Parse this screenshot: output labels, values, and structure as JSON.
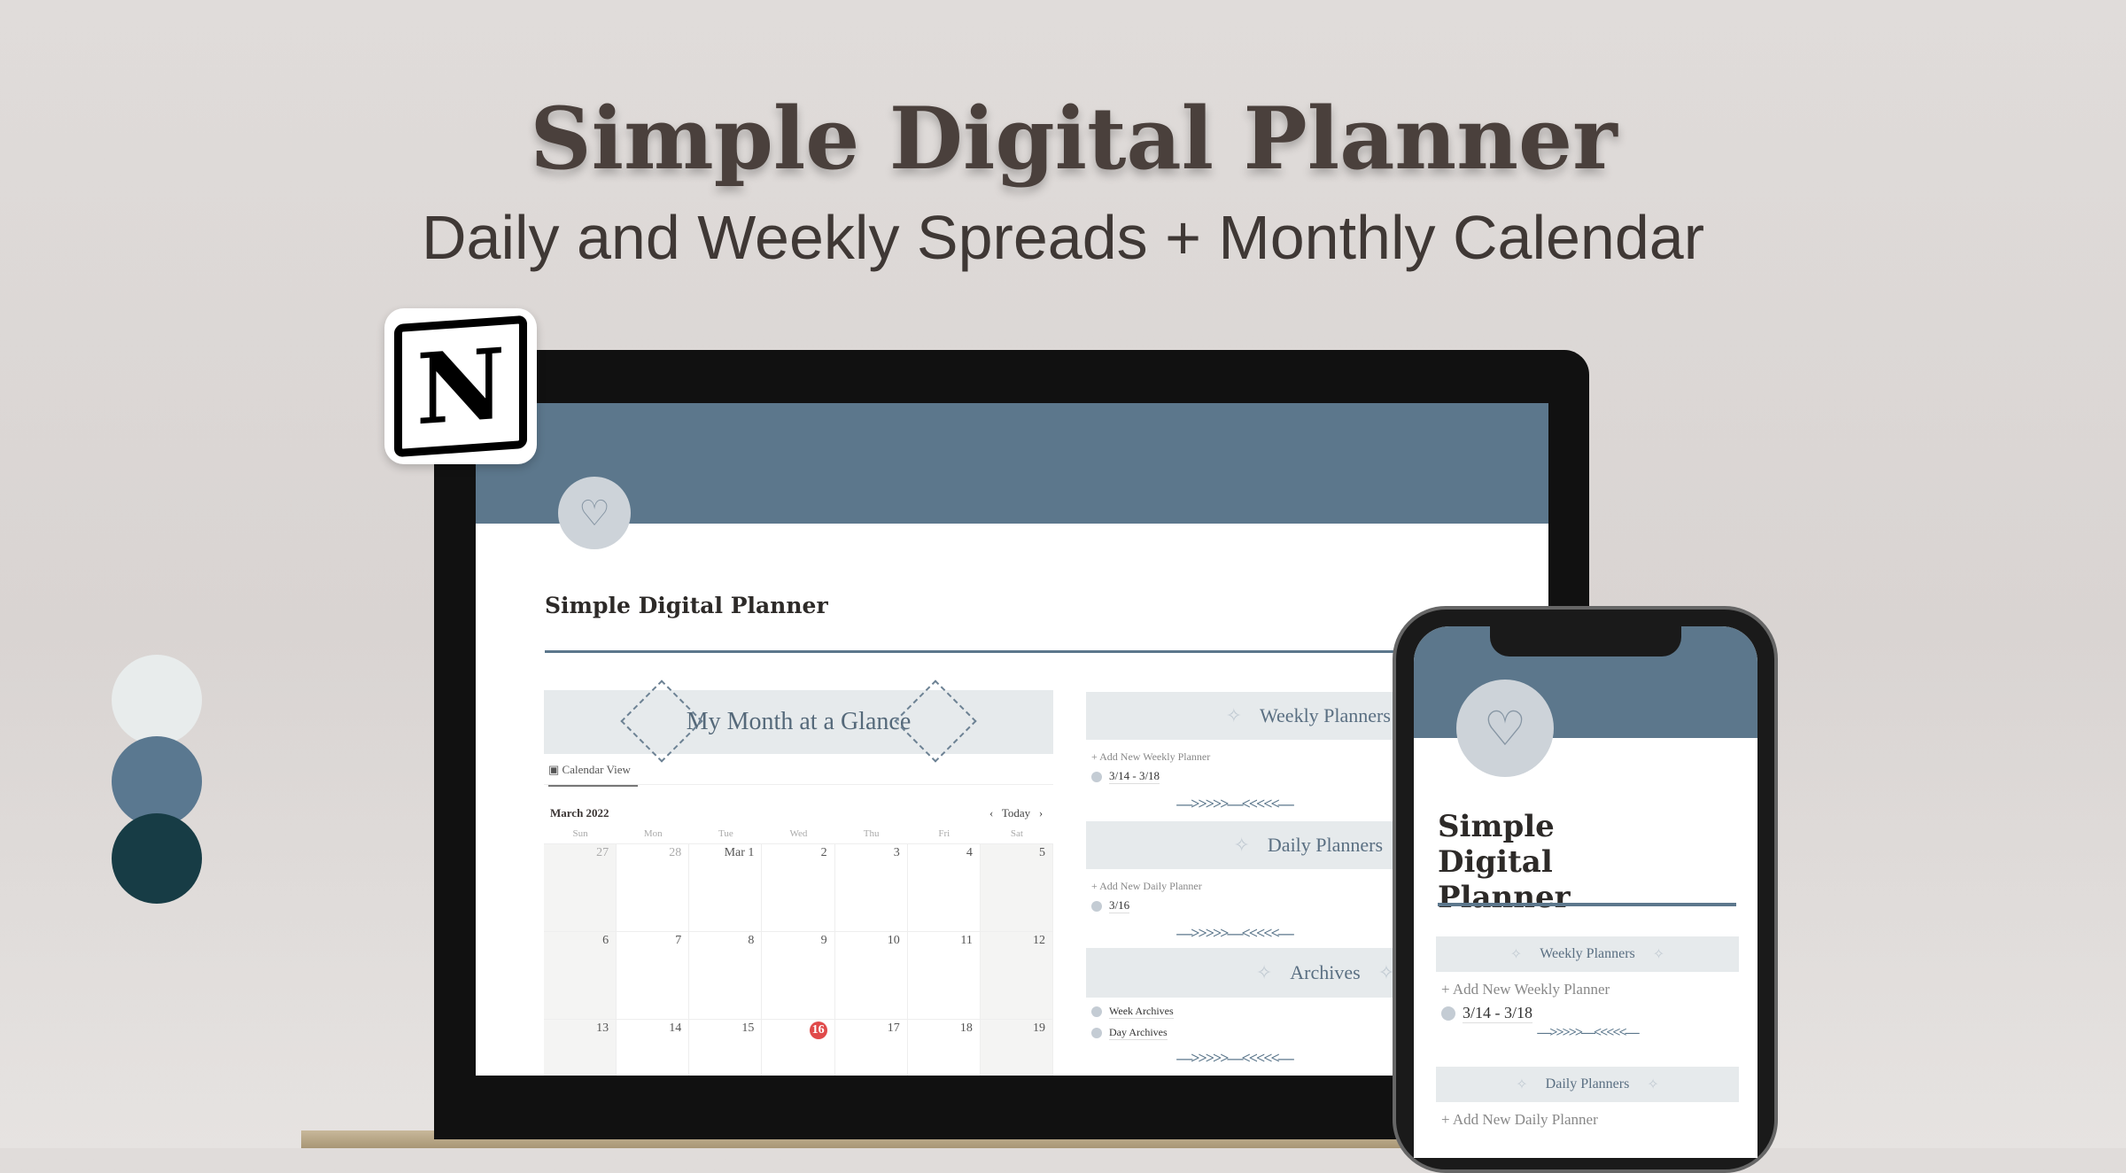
{
  "headline": {
    "title": "Simple Digital Planner",
    "subtitle": "Daily and Weekly Spreads + Monthly Calendar"
  },
  "palette": [
    "#e8ecec",
    "#5a7890",
    "#173c45"
  ],
  "logo": {
    "letter": "N",
    "name": "notion-logo"
  },
  "laptop": {
    "page_title": "Simple Digital Planner",
    "month_banner": "My Month at a Glance",
    "view_tab": "Calendar View",
    "calendar": {
      "month": "March 2022",
      "today_label": "Today",
      "prev": "‹",
      "next": "›",
      "weekdays": [
        "Sun",
        "Mon",
        "Tue",
        "Wed",
        "Thu",
        "Fri",
        "Sat"
      ],
      "days": [
        "27",
        "28",
        "Mar 1",
        "2",
        "3",
        "4",
        "5",
        "6",
        "7",
        "8",
        "9",
        "10",
        "11",
        "12",
        "13",
        "14",
        "15",
        "16",
        "17",
        "18",
        "19"
      ],
      "today": "16"
    },
    "weekly": {
      "header": "Weekly Planners",
      "add": "+ Add New Weekly Planner",
      "items": [
        "3/14 - 3/18"
      ]
    },
    "daily": {
      "header": "Daily Planners",
      "add": "+ Add New Daily Planner",
      "items": [
        "3/16"
      ]
    },
    "archives": {
      "header": "Archives",
      "items": [
        "Week Archives",
        "Day Archives"
      ]
    },
    "ornament": "—>>>>>—<<<<<—"
  },
  "phone": {
    "page_title": "Simple Digital Planner",
    "weekly": {
      "header": "Weekly Planners",
      "add": "+ Add New Weekly Planner",
      "items": [
        "3/14 - 3/18"
      ]
    },
    "daily": {
      "header": "Daily Planners",
      "add": "+ Add New Daily Planner"
    },
    "ornament": "—>>>>>—<<<<<—"
  }
}
